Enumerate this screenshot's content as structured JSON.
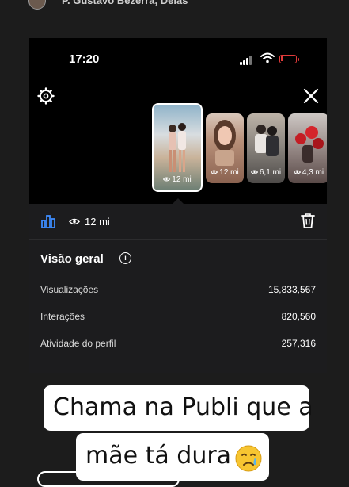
{
  "story_header": {
    "username": "P. Gustavo Bezerra, Delas"
  },
  "status_bar": {
    "time": "17:20",
    "battery_color": "#e03a3a"
  },
  "reels_strip": {
    "icons": {
      "settings": "gear-icon",
      "close": "close-icon"
    },
    "thumbnails": [
      {
        "views": "12 mi",
        "selected": true
      },
      {
        "views": "12 mi",
        "selected": false
      },
      {
        "views": "6,1 mi",
        "selected": false
      },
      {
        "views": "4,3 mi",
        "selected": false
      }
    ]
  },
  "insights": {
    "toolbar": {
      "views_count": "12 mi",
      "icons": {
        "chart": "bar-chart-icon",
        "views": "eye-icon",
        "delete": "trash-icon"
      },
      "accent_color": "#3d8bfd"
    },
    "overview": {
      "title": "Visão geral",
      "rows": [
        {
          "label": "Visualizações",
          "value": "15,833,567"
        },
        {
          "label": "Interações",
          "value": "820,560"
        },
        {
          "label": "Atividade do perfil",
          "value": "257,316"
        }
      ]
    }
  },
  "caption": {
    "line1": "Chama na Publi que a",
    "line2": "mãe tá dura",
    "emoji": "crying-face-icon"
  }
}
